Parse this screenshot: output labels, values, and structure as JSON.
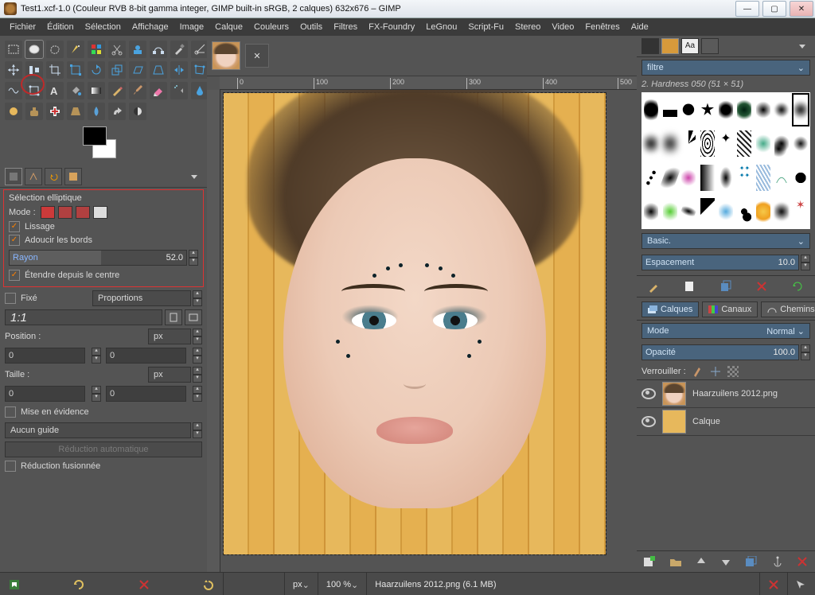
{
  "titlebar": {
    "text": "Test1.xcf-1.0 (Couleur RVB 8-bit gamma integer, GIMP built-in sRGB, 2 calques) 632x676 – GIMP"
  },
  "menu": {
    "items": [
      "Fichier",
      "Édition",
      "Sélection",
      "Affichage",
      "Image",
      "Calque",
      "Couleurs",
      "Outils",
      "Filtres",
      "FX-Foundry",
      "LeGnou",
      "Script-Fu",
      "Stereo",
      "Video",
      "Fenêtres",
      "Aide"
    ]
  },
  "tool_options": {
    "title": "Sélection elliptique",
    "mode_label": "Mode :",
    "antialias": "Lissage",
    "feather": "Adoucir les bords",
    "radius_label": "Rayon",
    "radius_value": "52.0",
    "expand_center": "Étendre depuis le centre",
    "fixed_label": "Fixé",
    "fixed_select": "Proportions",
    "ratio": "1:1",
    "position_label": "Position :",
    "position_unit": "px",
    "pos_x": "0",
    "pos_y": "0",
    "size_label": "Taille :",
    "size_unit": "px",
    "size_w": "0",
    "size_h": "0",
    "highlight": "Mise en évidence",
    "guides": "Aucun guide",
    "autoshrink": "Réduction automatique",
    "shrink_merged": "Réduction fusionnée"
  },
  "ruler_marks": [
    "0",
    "100",
    "200",
    "300",
    "400",
    "500"
  ],
  "statusbar": {
    "unit": "px",
    "zoom": "100 %",
    "file_info": "Haarzuilens 2012.png (6.1 MB)"
  },
  "brushes": {
    "filter_placeholder": "filtre",
    "current": "2. Hardness 050 (51 × 51)",
    "preset_label": "Basic.",
    "spacing_label": "Espacement",
    "spacing_value": "10.0"
  },
  "layer_dock": {
    "tabs": [
      "Calques",
      "Canaux",
      "Chemins"
    ],
    "mode_label": "Mode",
    "mode_value": "Normal",
    "opacity_label": "Opacité",
    "opacity_value": "100.0",
    "lock_label": "Verrouiller :",
    "layers": [
      {
        "name": "Haarzuilens 2012.png"
      },
      {
        "name": "Calque"
      }
    ]
  }
}
